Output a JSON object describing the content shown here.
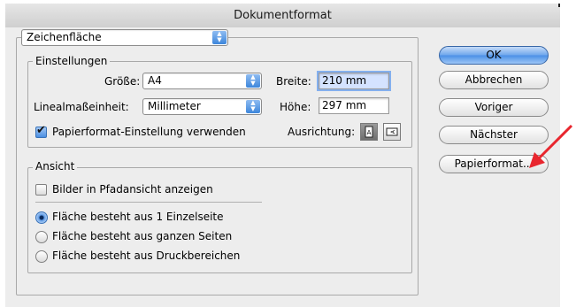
{
  "window": {
    "title": "Dokumentformat"
  },
  "document_type": {
    "selected": "Zeichenfläche"
  },
  "settings": {
    "legend": "Einstellungen",
    "size_label": "Größe:",
    "size_value": "A4",
    "unit_label": "Linealmaßeinheit:",
    "unit_value": "Millimeter",
    "width_label": "Breite:",
    "width_value": "210 mm",
    "height_label": "Höhe:",
    "height_value": "297 mm",
    "use_page_setup_label": "Papierformat-Einstellung verwenden",
    "use_page_setup_checked": true,
    "orientation_label": "Ausrichtung:"
  },
  "view": {
    "legend": "Ansicht",
    "path_view_label": "Bilder in Pfadansicht anzeigen",
    "path_view_checked": false,
    "options": [
      {
        "label": "Fläche besteht aus 1 Einzelseite",
        "selected": true
      },
      {
        "label": "Fläche besteht aus ganzen Seiten",
        "selected": false
      },
      {
        "label": "Fläche besteht aus Druckbereichen",
        "selected": false
      }
    ]
  },
  "buttons": {
    "ok": "OK",
    "cancel": "Abbrechen",
    "previous": "Voriger",
    "next": "Nächster",
    "page_setup": "Papierformat..."
  },
  "colors": {
    "accent": "#4a8fe6",
    "annotation_arrow": "#e8262e"
  },
  "icons": {
    "orientation_portrait": "portrait-orientation-icon",
    "orientation_landscape": "landscape-orientation-icon",
    "popup_arrows": "updown-arrows-icon",
    "pointer": "red-arrow-icon"
  }
}
